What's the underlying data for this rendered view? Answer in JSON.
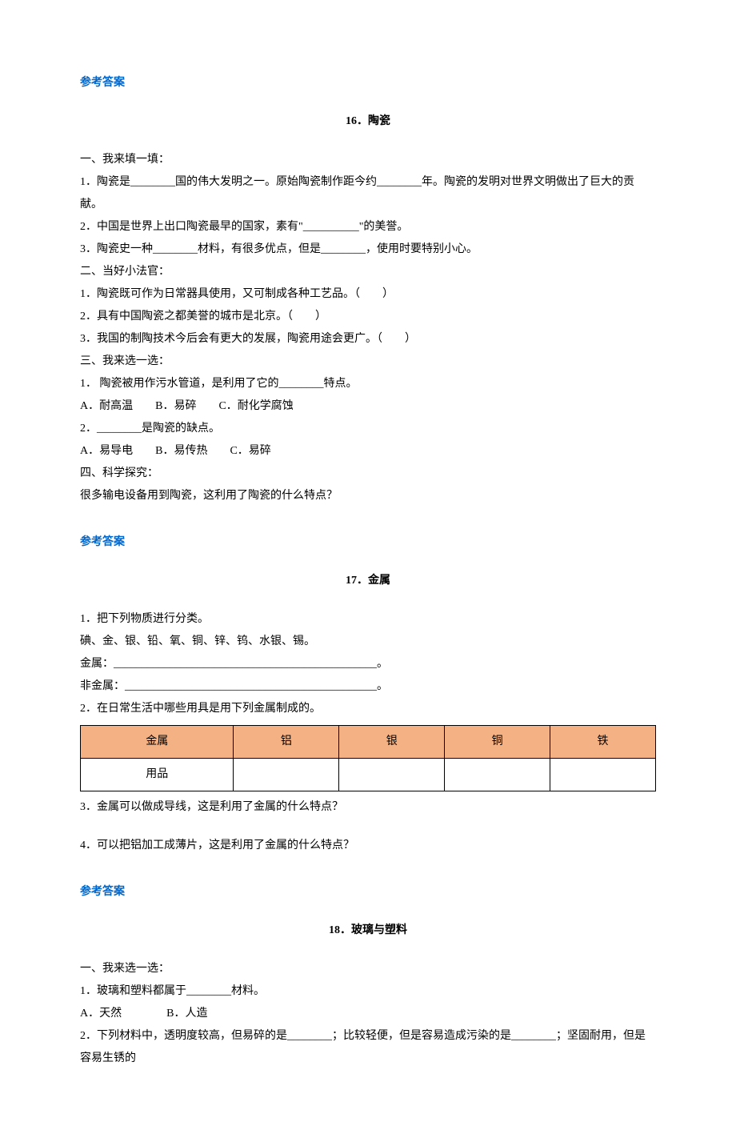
{
  "ans1": "参考答案",
  "s16": {
    "title": "16．陶瓷",
    "p1_h": "一、我来填一填：",
    "p1_1": "1．陶瓷是________国的伟大发明之一。原始陶瓷制作距今约________年。陶瓷的发明对世界文明做出了巨大的贡献。",
    "p1_2": "2．中国是世界上出口陶瓷最早的国家，素有\"__________\"的美誉。",
    "p1_3": "3．陶瓷史一种________材料，有很多优点，但是________，使用时要特别小心。",
    "p2_h": "二、当好小法官：",
    "p2_1": "1．陶瓷既可作为日常器具使用，又可制成各种工艺品。（　　）",
    "p2_2": "2．具有中国陶瓷之都美誉的城市是北京。（　　）",
    "p2_3": "3．我国的制陶技术今后会有更大的发展，陶瓷用途会更广。（　　）",
    "p3_h": "三、我来选一选：",
    "p3_1": "1．  陶瓷被用作污水管道，是利用了它的________特点。",
    "p3_1o": "A．耐高温　　B．易碎　　C．耐化学腐蚀",
    "p3_2": "2．________是陶瓷的缺点。",
    "p3_2o": "A．易导电　　B．易传热　　C．易碎",
    "p4_h": "四、科学探究：",
    "p4_1": "很多输电设备用到陶瓷，这利用了陶瓷的什么特点？"
  },
  "ans2": "参考答案",
  "s17": {
    "title": "17．金属",
    "q1": "1．把下列物质进行分类。",
    "q1a": "碘、金、银、铅、氧、铜、锌、钨、水银、锡。",
    "q1b": "金属：_______________________________________________。",
    "q1c": "非金属：_____________________________________________。",
    "q2": "2．在日常生活中哪些用具是用下列金属制成的。",
    "table": {
      "h1": "金属",
      "h2": "铝",
      "h3": "银",
      "h4": "铜",
      "h5": "铁",
      "r1": "用品",
      "r2": "",
      "r3": "",
      "r4": "",
      "r5": ""
    },
    "q3": "3．金属可以做成导线，这是利用了金属的什么特点？",
    "q4": "4．可以把铝加工成薄片，这是利用了金属的什么特点？"
  },
  "ans3": "参考答案",
  "s18": {
    "title": "18．玻璃与塑料",
    "p1_h": "一、我来选一选：",
    "p1_1": "1．玻璃和塑料都属于________材料。",
    "p1_1o": "A．天然　　　　B．人造",
    "p1_2": "2．下列材料中，透明度较高，但易碎的是________；比较轻便，但是容易造成污染的是________；坚固耐用，但是容易生锈的"
  }
}
